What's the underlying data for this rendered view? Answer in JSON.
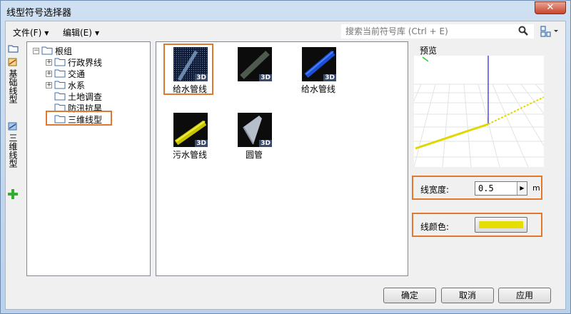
{
  "window": {
    "title": "线型符号选择器",
    "close_glyph": "✕"
  },
  "menu": {
    "file": "文件(F)",
    "edit": "编辑(E)",
    "arrow": "▼"
  },
  "search": {
    "placeholder": "搜索当前符号库 (Ctrl + E)"
  },
  "side_tabs": {
    "tab1": "基础线型",
    "tab2": "三维线型",
    "add_glyph": "+"
  },
  "tree": {
    "root": "根组",
    "items": [
      "行政界线",
      "交通",
      "水系",
      "土地调查",
      "防汛抗旱",
      "三维线型"
    ],
    "expand_glyph": "+",
    "collapse_glyph": "−"
  },
  "symbols": [
    {
      "label": "给水管线",
      "badge": "3D"
    },
    {
      "label": "",
      "badge": "3D"
    },
    {
      "label": "给水管线",
      "badge": "3D"
    },
    {
      "label": "污水管线",
      "badge": "3D"
    },
    {
      "label": "圆管",
      "badge": "3D"
    }
  ],
  "preview": {
    "label": "预览"
  },
  "line_width": {
    "label": "线宽度:",
    "value": "0.5",
    "unit": "m",
    "spin_glyph": "▶"
  },
  "line_color": {
    "label": "线颜色:",
    "value": "#e6de00"
  },
  "buttons": {
    "ok": "确定",
    "cancel": "取消",
    "apply": "应用"
  },
  "colors": {
    "highlight": "#e0782e",
    "accent": "#3c6fb0"
  }
}
